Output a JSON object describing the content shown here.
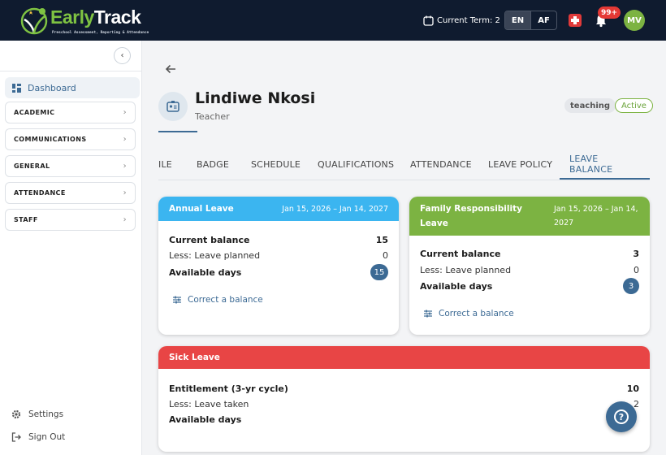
{
  "app": {
    "name_part1": "Early",
    "name_part2": "Track",
    "tagline": "Preschool Assessment, Reporting & Attendance"
  },
  "header": {
    "term_label": "Current Term: 2",
    "languages": [
      "EN",
      "AF"
    ],
    "active_language": "EN",
    "notification_count": "99+",
    "avatar_initials": "MV"
  },
  "sidebar": {
    "collapse_icon": "chevron-left-icon",
    "dashboard_label": "Dashboard",
    "sections": [
      {
        "label": "ACADEMIC"
      },
      {
        "label": "COMMUNICATIONS"
      },
      {
        "label": "GENERAL"
      },
      {
        "label": "ATTENDANCE"
      },
      {
        "label": "STAFF"
      }
    ],
    "settings_label": "Settings",
    "signout_label": "Sign Out"
  },
  "profile": {
    "name": "Lindiwe Nkosi",
    "role": "Teacher",
    "type_chip": "teaching",
    "status_chip": "Active"
  },
  "tabs": [
    "ILE",
    "BADGE",
    "SCHEDULE",
    "QUALIFICATIONS",
    "ATTENDANCE",
    "LEAVE POLICY",
    "LEAVE BALANCE"
  ],
  "active_tab": "LEAVE BALANCE",
  "cards": {
    "annual": {
      "title": "Annual Leave",
      "dates": "Jan 15, 2026 – Jan 14, 2027",
      "color": "#3bb5f0",
      "rows": [
        {
          "label": "Current balance",
          "value": "15"
        },
        {
          "label": "Less: Leave planned",
          "value": "0"
        },
        {
          "label": "Available days",
          "value": "15"
        }
      ],
      "action": "Correct a balance"
    },
    "family": {
      "title": "Family Responsibility Leave",
      "dates": "Jan 15, 2026 – Jan 14, 2027",
      "color": "#7cb342",
      "rows": [
        {
          "label": "Current balance",
          "value": "3"
        },
        {
          "label": "Less: Leave planned",
          "value": "0"
        },
        {
          "label": "Available days",
          "value": "3"
        }
      ],
      "action": "Correct a balance"
    },
    "sick": {
      "title": "Sick Leave",
      "color": "#e84545",
      "rows": [
        {
          "label": "Entitlement (3-yr cycle)",
          "value": "10"
        },
        {
          "label": "Less: Leave taken",
          "value": "2"
        },
        {
          "label": "Available days",
          "value": ""
        }
      ]
    }
  },
  "colors": {
    "topbar": "#0f1b2f",
    "accent": "#3c6a94",
    "brand_green": "#7cb342"
  }
}
